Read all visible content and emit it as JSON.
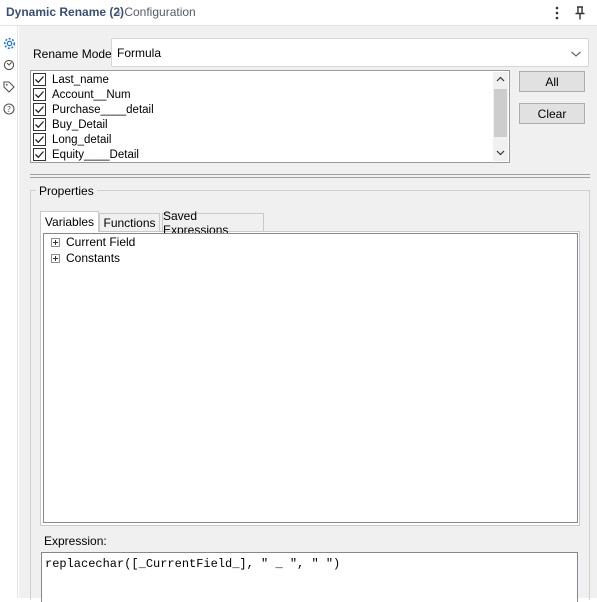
{
  "header": {
    "title": "Dynamic Rename (2)",
    "subtitle": "- Configuration",
    "more_icon": "more-vertical-icon",
    "pin_icon": "pin-icon"
  },
  "rail": {
    "icons": [
      "gear-icon",
      "refresh-icon",
      "tag-icon",
      "help-icon"
    ],
    "accent": "#2b78c5"
  },
  "rename_mode": {
    "label": "Rename Mode:",
    "value": "Formula"
  },
  "fields": [
    {
      "label": "Last_name",
      "checked": true
    },
    {
      "label": "Account__Num",
      "checked": true
    },
    {
      "label": "Purchase____detail",
      "checked": true
    },
    {
      "label": "Buy_Detail",
      "checked": true
    },
    {
      "label": "Long_detail",
      "checked": true
    },
    {
      "label": "Equity____Detail",
      "checked": true
    }
  ],
  "buttons": {
    "all": "All",
    "clear": "Clear"
  },
  "properties": {
    "label": "Properties",
    "tabs": [
      {
        "label": "Variables",
        "active": true
      },
      {
        "label": "Functions",
        "active": false
      },
      {
        "label": "Saved Expressions",
        "active": false
      }
    ],
    "tree": [
      {
        "label": "Current Field"
      },
      {
        "label": "Constants"
      }
    ]
  },
  "expression": {
    "label": "Expression:",
    "value": "replacechar([_CurrentField_], \" _ \", \" \")"
  },
  "colors": {
    "title": "#3b4f71",
    "panel_bg": "#f0f0f0"
  }
}
